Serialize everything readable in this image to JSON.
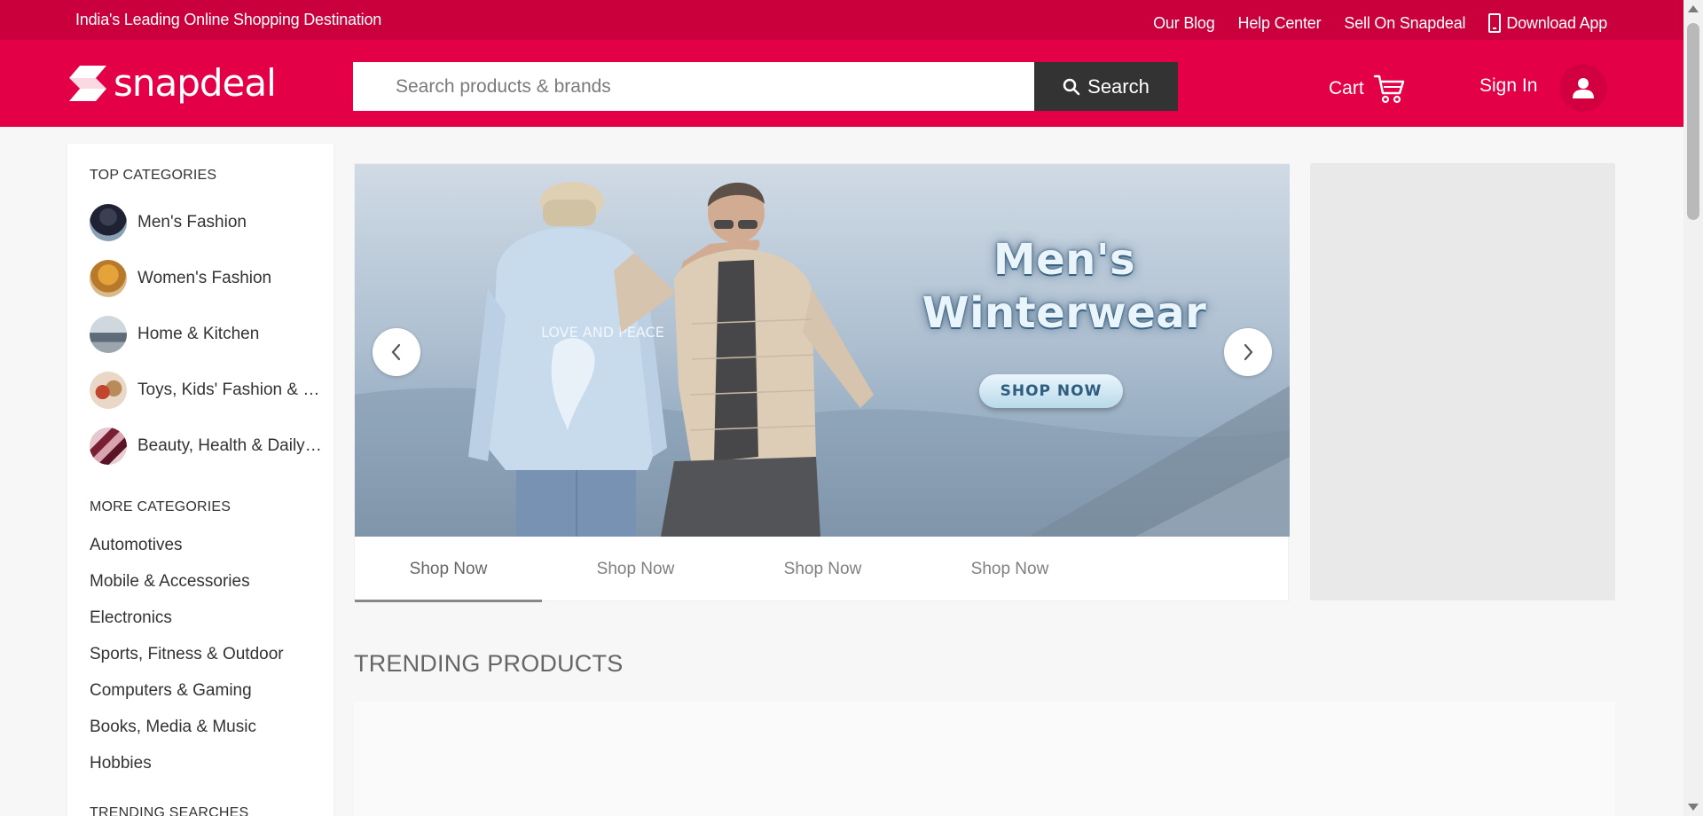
{
  "top_strip": {
    "tagline": "India's Leading Online Shopping Destination",
    "links": [
      "Our Blog",
      "Help Center",
      "Sell On Snapdeal"
    ],
    "download_label": "Download App"
  },
  "header": {
    "logo_text": "snapdeal",
    "search_placeholder": "Search products & brands",
    "search_button": "Search",
    "cart_label": "Cart",
    "signin_label": "Sign In"
  },
  "sidebar": {
    "top_title": "TOP CATEGORIES",
    "top_categories": [
      {
        "label": "Men's Fashion"
      },
      {
        "label": "Women's Fashion"
      },
      {
        "label": "Home & Kitchen"
      },
      {
        "label": "Toys, Kids' Fashion & more"
      },
      {
        "label": "Beauty, Health & Daily Needs"
      }
    ],
    "more_title": "MORE CATEGORIES",
    "more_categories": [
      "Automotives",
      "Mobile & Accessories",
      "Electronics",
      "Sports, Fitness & Outdoor",
      "Computers & Gaming",
      "Books, Media & Music",
      "Hobbies"
    ],
    "trending_searches_title": "TRENDING SEARCHES"
  },
  "banner": {
    "title_line1": "Men's",
    "title_line2": "Winterwear",
    "cta": "SHOP NOW",
    "hoodie_text": "LOVE AND PEACE",
    "tabs": [
      "Shop Now",
      "Shop Now",
      "Shop Now",
      "Shop Now"
    ],
    "active_tab": 0
  },
  "trending": {
    "title": "TRENDING PRODUCTS"
  },
  "colors": {
    "top_strip": "#c9003b",
    "header": "#e40046",
    "search_button": "#333333"
  }
}
